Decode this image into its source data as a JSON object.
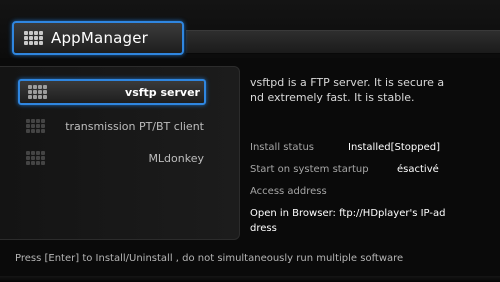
{
  "header": {
    "title": "AppManager",
    "icon": "app-grid-icon"
  },
  "packages": [
    {
      "label": "vsftp server",
      "icon": "package-grid-icon",
      "selected": true
    },
    {
      "label": "transmission PT/BT client",
      "icon": "package-grid-icon",
      "selected": false
    },
    {
      "label": "MLdonkey",
      "icon": "package-grid-icon",
      "selected": false
    }
  ],
  "details": {
    "description": "vsftpd is a FTP server. It is secure and extremely fast. It is stable.",
    "install_status_label": "Install status",
    "install_status_value": "Installed[Stopped]",
    "startup_label": "Start on system startup",
    "startup_value": "ésactivé",
    "access_label": "Access address",
    "open_browser": "Open in Browser: ftp://HDplayer's IP-address"
  },
  "footer": {
    "hint": "Press [Enter] to Install/Uninstall , do not simultaneously run multiple software"
  },
  "colors": {
    "accent": "#2f86e0",
    "background": "#0a0a0a"
  }
}
